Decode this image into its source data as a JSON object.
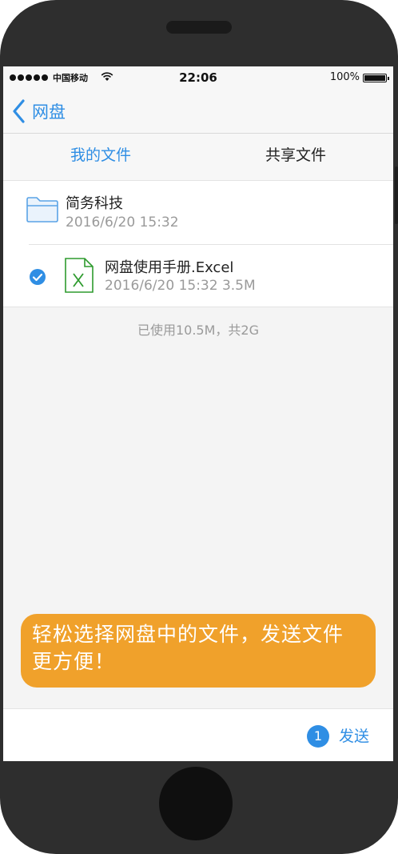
{
  "status_bar": {
    "carrier": "中国移动",
    "time": "22:06",
    "battery": "100%"
  },
  "nav": {
    "back_label": "网盘"
  },
  "tabs": [
    {
      "label": "我的文件",
      "active": true
    },
    {
      "label": "共享文件",
      "active": false
    }
  ],
  "files": [
    {
      "name": "简务科技",
      "meta": "2016/6/20   15:32",
      "icon": "folder-icon",
      "selected": false
    },
    {
      "name": "网盘使用手册.Excel",
      "meta": "2016/6/20   15:32   3.5M",
      "icon": "excel-file-icon",
      "selected": true
    }
  ],
  "storage_text": "已使用10.5M，共2G",
  "promo": {
    "line1": "轻松选择网盘中的文件，发送文件",
    "line2": "更方便！"
  },
  "bottom_bar": {
    "selected_count": "1",
    "send_label": "发送"
  },
  "colors": {
    "accent": "#2f8ee4",
    "promo_bg": "#f0a12b",
    "excel_green": "#2e9b2e"
  }
}
